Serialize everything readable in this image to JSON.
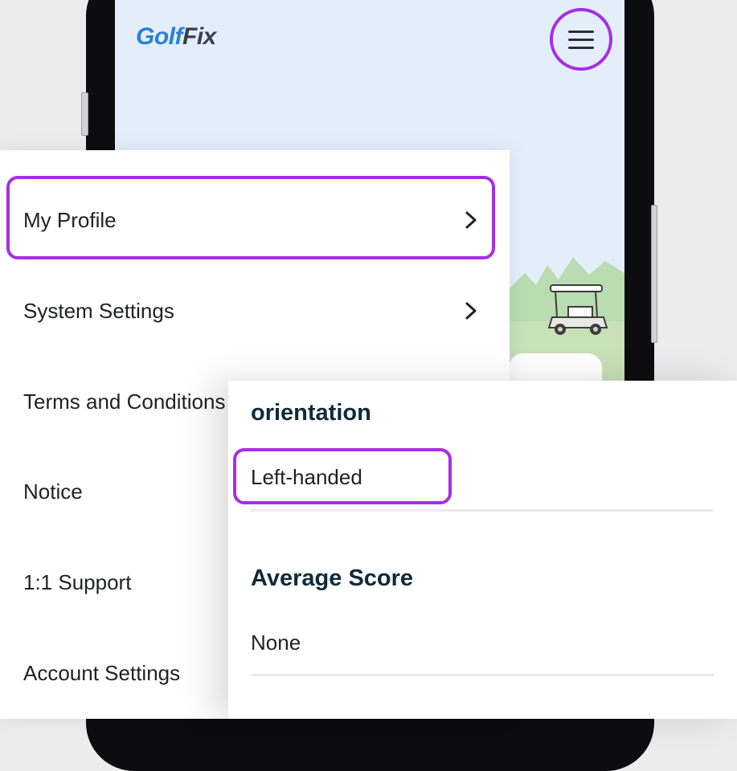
{
  "app": {
    "logo_text_part1": "Golf",
    "logo_text_part2": "Fix"
  },
  "header": {
    "menu_icon": "hamburger-menu-icon"
  },
  "menu": {
    "items": [
      {
        "label": "My Profile",
        "has_chevron": true,
        "highlighted": true
      },
      {
        "label": "System Settings",
        "has_chevron": true
      },
      {
        "label": "Terms and Conditions",
        "has_chevron": false
      },
      {
        "label": "Notice",
        "has_chevron": false
      },
      {
        "label": "1:1 Support",
        "has_chevron": false
      },
      {
        "label": "Account Settings",
        "has_chevron": false
      }
    ]
  },
  "profile": {
    "orientation": {
      "title": "orientation",
      "value": "Left-handed"
    },
    "average_score": {
      "title": "Average Score",
      "value": "None"
    }
  },
  "colors": {
    "highlight": "#a62ee6",
    "logo_blue": "#2b7fd8",
    "heading": "#0e2a3b"
  }
}
